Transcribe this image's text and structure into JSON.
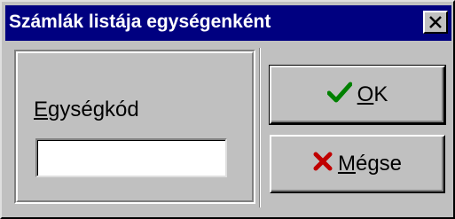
{
  "window": {
    "title": "Számlák listája egységenként",
    "close_icon": "close-icon"
  },
  "form": {
    "unit_label_mnemonic": "E",
    "unit_label_rest": "gységkód",
    "unit_input_value": ""
  },
  "buttons": {
    "ok_mnemonic": "O",
    "ok_rest": "K",
    "ok_icon": "checkmark-icon",
    "ok_icon_color": "#008000",
    "cancel_mnemonic": "M",
    "cancel_rest": "égse",
    "cancel_icon": "x-icon",
    "cancel_icon_color": "#c00000"
  },
  "colors": {
    "title_bar": "#000080",
    "face": "#c0c0c0"
  }
}
